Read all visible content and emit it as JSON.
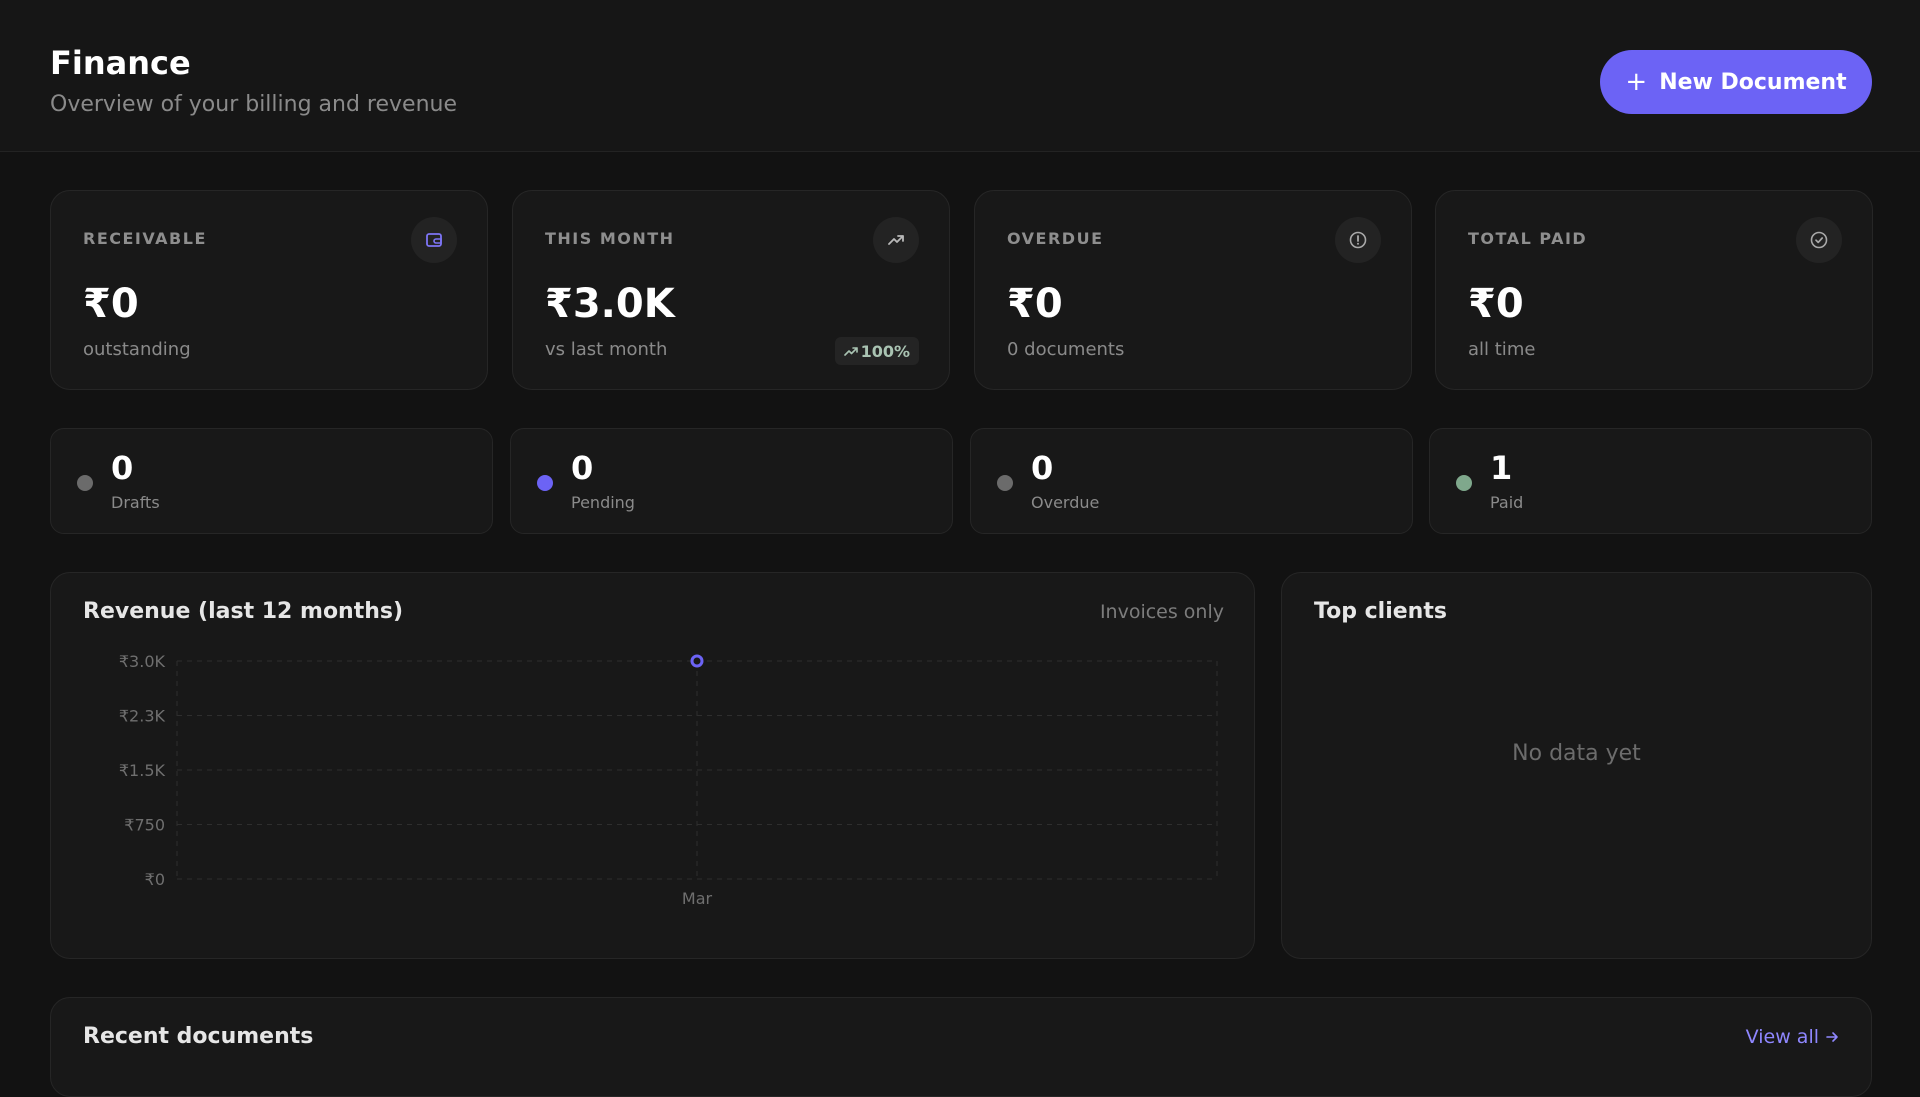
{
  "header": {
    "title": "Finance",
    "subtitle": "Overview of your billing and revenue",
    "new_doc_label": "New Document"
  },
  "stats": [
    {
      "label": "RECEIVABLE",
      "value": "₹0",
      "sub": "outstanding",
      "icon": "wallet-icon"
    },
    {
      "label": "THIS MONTH",
      "value": "₹3.0K",
      "sub": "vs last month",
      "icon": "trending-up-icon",
      "badge": "100%"
    },
    {
      "label": "OVERDUE",
      "value": "₹0",
      "sub": "0 documents",
      "icon": "alert-circle-icon"
    },
    {
      "label": "TOTAL PAID",
      "value": "₹0",
      "sub": "all time",
      "icon": "check-circle-icon"
    }
  ],
  "counts": [
    {
      "value": "0",
      "label": "Drafts",
      "color": "#6b6b6b"
    },
    {
      "value": "0",
      "label": "Pending",
      "color": "#6c63f5"
    },
    {
      "value": "0",
      "label": "Overdue",
      "color": "#6b6b6b"
    },
    {
      "value": "1",
      "label": "Paid",
      "color": "#7fa88c"
    }
  ],
  "revenue": {
    "title": "Revenue (last 12 months)",
    "note": "Invoices only"
  },
  "chart_data": {
    "type": "line",
    "x": [
      "Mar"
    ],
    "y_ticks": [
      "₹3.0K",
      "₹2.3K",
      "₹1.5K",
      "₹750",
      "₹0"
    ],
    "series": [
      {
        "values": [
          3000
        ]
      }
    ],
    "ylim": [
      0,
      3000
    ],
    "grid": true,
    "color": "#6c63f5"
  },
  "clients": {
    "title": "Top clients",
    "empty": "No data yet"
  },
  "recent": {
    "title": "Recent documents",
    "view_all": "View all"
  }
}
